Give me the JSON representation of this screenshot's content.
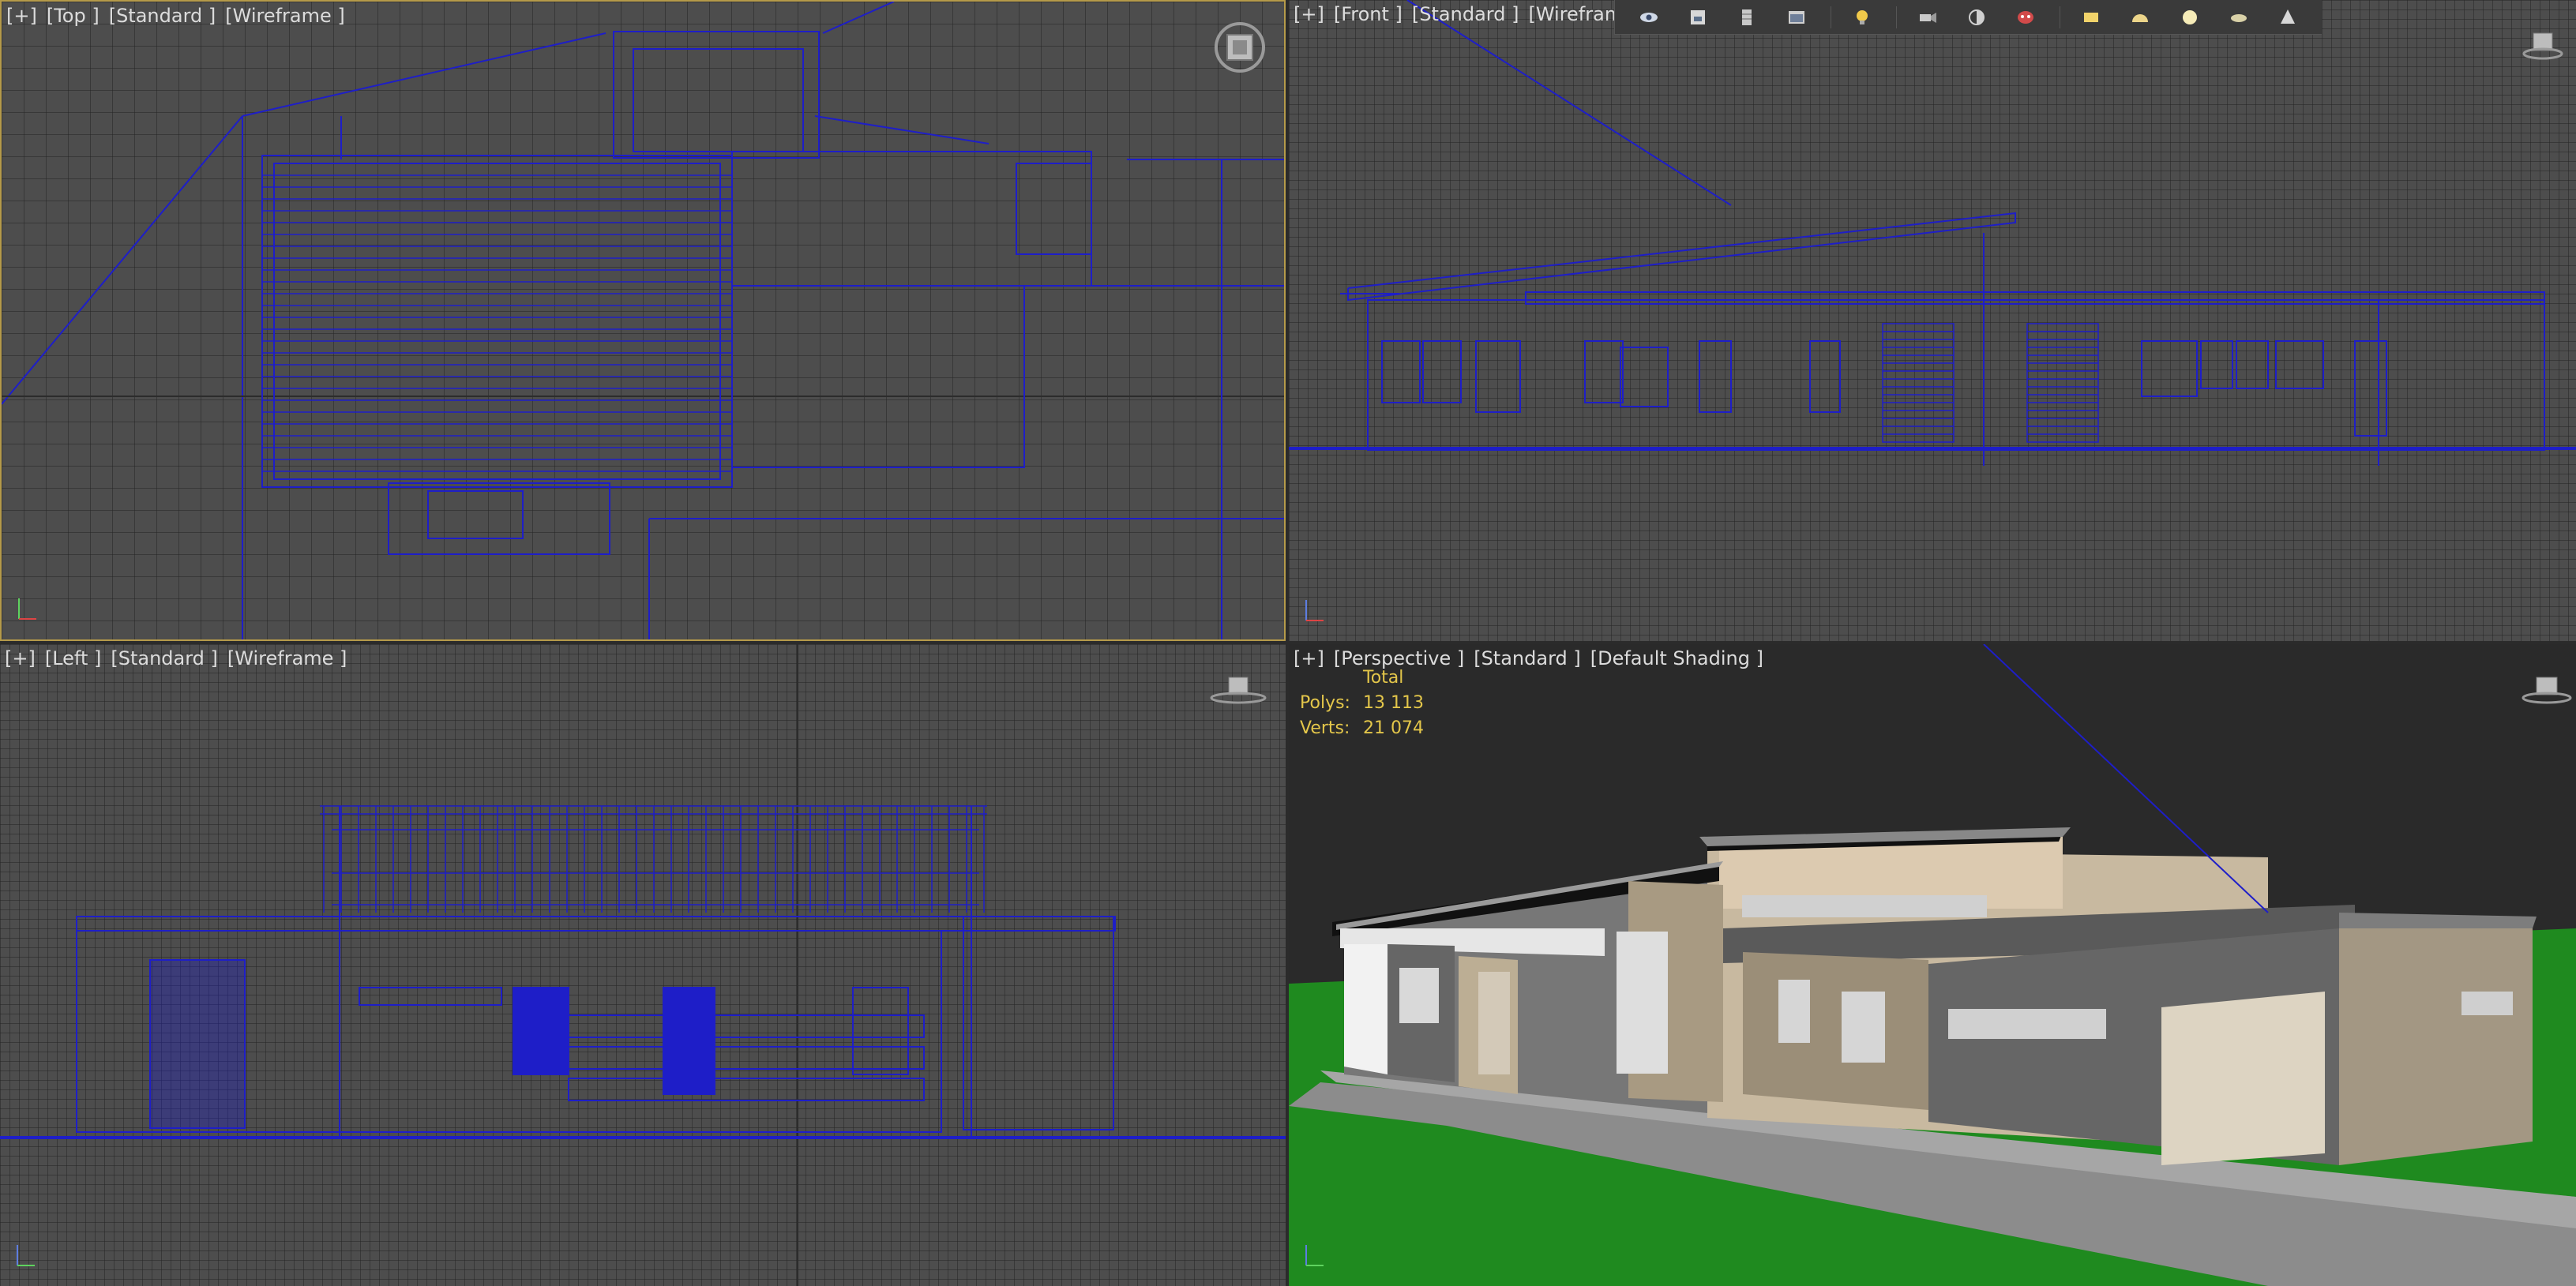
{
  "viewports": {
    "top": {
      "plus": "[+]",
      "view": "[Top ]",
      "mode": "[Standard ]",
      "shading": "[Wireframe ]"
    },
    "front": {
      "plus": "[+]",
      "view": "[Front ]",
      "mode": "[Standard ]",
      "shading": "[Wireframe ]"
    },
    "left": {
      "plus": "[+]",
      "view": "[Left ]",
      "mode": "[Standard ]",
      "shading": "[Wireframe ]"
    },
    "perspective": {
      "plus": "[+]",
      "view": "[Perspective ]",
      "mode": "[Standard ]",
      "shading": "[Default Shading ]"
    }
  },
  "stats": {
    "title": "Total",
    "polys_label": "Polys:",
    "polys_value": "13 113",
    "verts_label": "Verts:",
    "verts_value": "21 074"
  },
  "toolbar": {
    "icons": [
      "eye-icon",
      "render-icon",
      "layer-icon",
      "frame-icon",
      "light-bulb-icon",
      "camera-icon",
      "spot-icon",
      "mask-icon",
      "rect-light-icon",
      "dome-icon",
      "sphere-icon",
      "disc-icon",
      "cone-icon"
    ]
  },
  "colors": {
    "wire": "#1e1ec8",
    "active_border": "#b59a4a",
    "stats": "#e3c64a",
    "ground": "#1f8a1f"
  }
}
